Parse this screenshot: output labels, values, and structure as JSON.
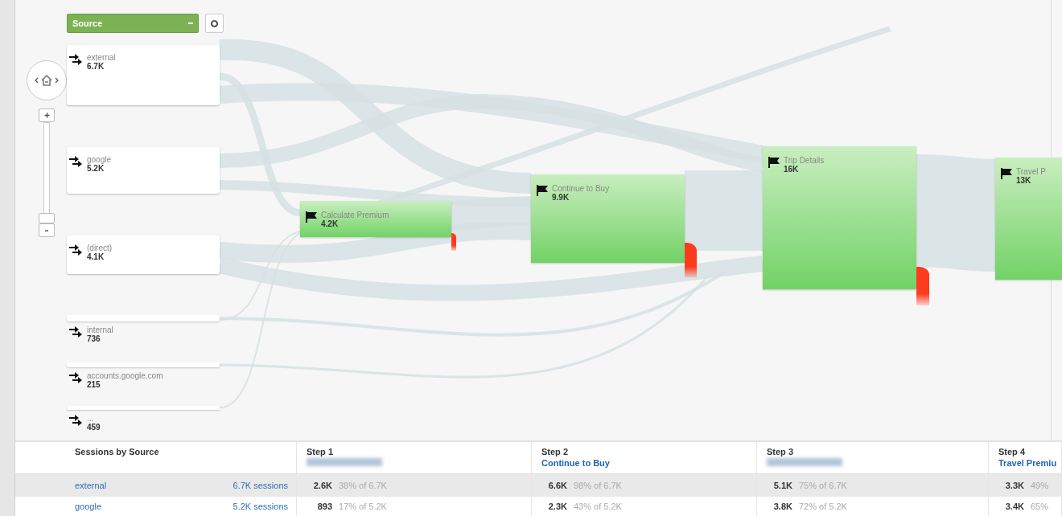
{
  "source_dropdown": {
    "label": "Source"
  },
  "sources": [
    {
      "label": "external",
      "value": "6.7K"
    },
    {
      "label": "google",
      "value": "5.2K"
    },
    {
      "label": "(direct)",
      "value": "4.1K"
    },
    {
      "label": "internal",
      "value": "736"
    },
    {
      "label": "accounts.google.com",
      "value": "215"
    },
    {
      "label": "...",
      "value": "459"
    }
  ],
  "goals": [
    {
      "label": "Calculate Premium",
      "value": "4.2K"
    },
    {
      "label": "Continue to Buy",
      "value": "9.9K"
    },
    {
      "label": "Trip Details",
      "value": "16K"
    },
    {
      "label": "Travel P",
      "value": "13K"
    }
  ],
  "table": {
    "dimension": "Sessions by Source",
    "steps": [
      {
        "title": "Step 1",
        "kind": "redacted"
      },
      {
        "title": "Step 2",
        "kind": "goal",
        "goal": "Continue to Buy"
      },
      {
        "title": "Step 3",
        "kind": "redacted"
      },
      {
        "title": "Step 4",
        "kind": "goal",
        "goal": "Travel Premiu"
      }
    ],
    "rows": [
      {
        "source": "external",
        "sessions": "6.7K sessions",
        "selected": true,
        "cells": [
          {
            "value": "2.6K",
            "share": "38% of 6.7K"
          },
          {
            "value": "6.6K",
            "share": "98% of 6.7K"
          },
          {
            "value": "5.1K",
            "share": "75% of 6.7K"
          },
          {
            "value": "3.3K",
            "share": "49%"
          }
        ]
      },
      {
        "source": "google",
        "sessions": "5.2K sessions",
        "selected": false,
        "cells": [
          {
            "value": "893",
            "share": "17% of 5.2K"
          },
          {
            "value": "2.3K",
            "share": "43% of 5.2K"
          },
          {
            "value": "3.8K",
            "share": "72% of 5.2K"
          },
          {
            "value": "3.4K",
            "share": "65%"
          }
        ]
      }
    ]
  }
}
